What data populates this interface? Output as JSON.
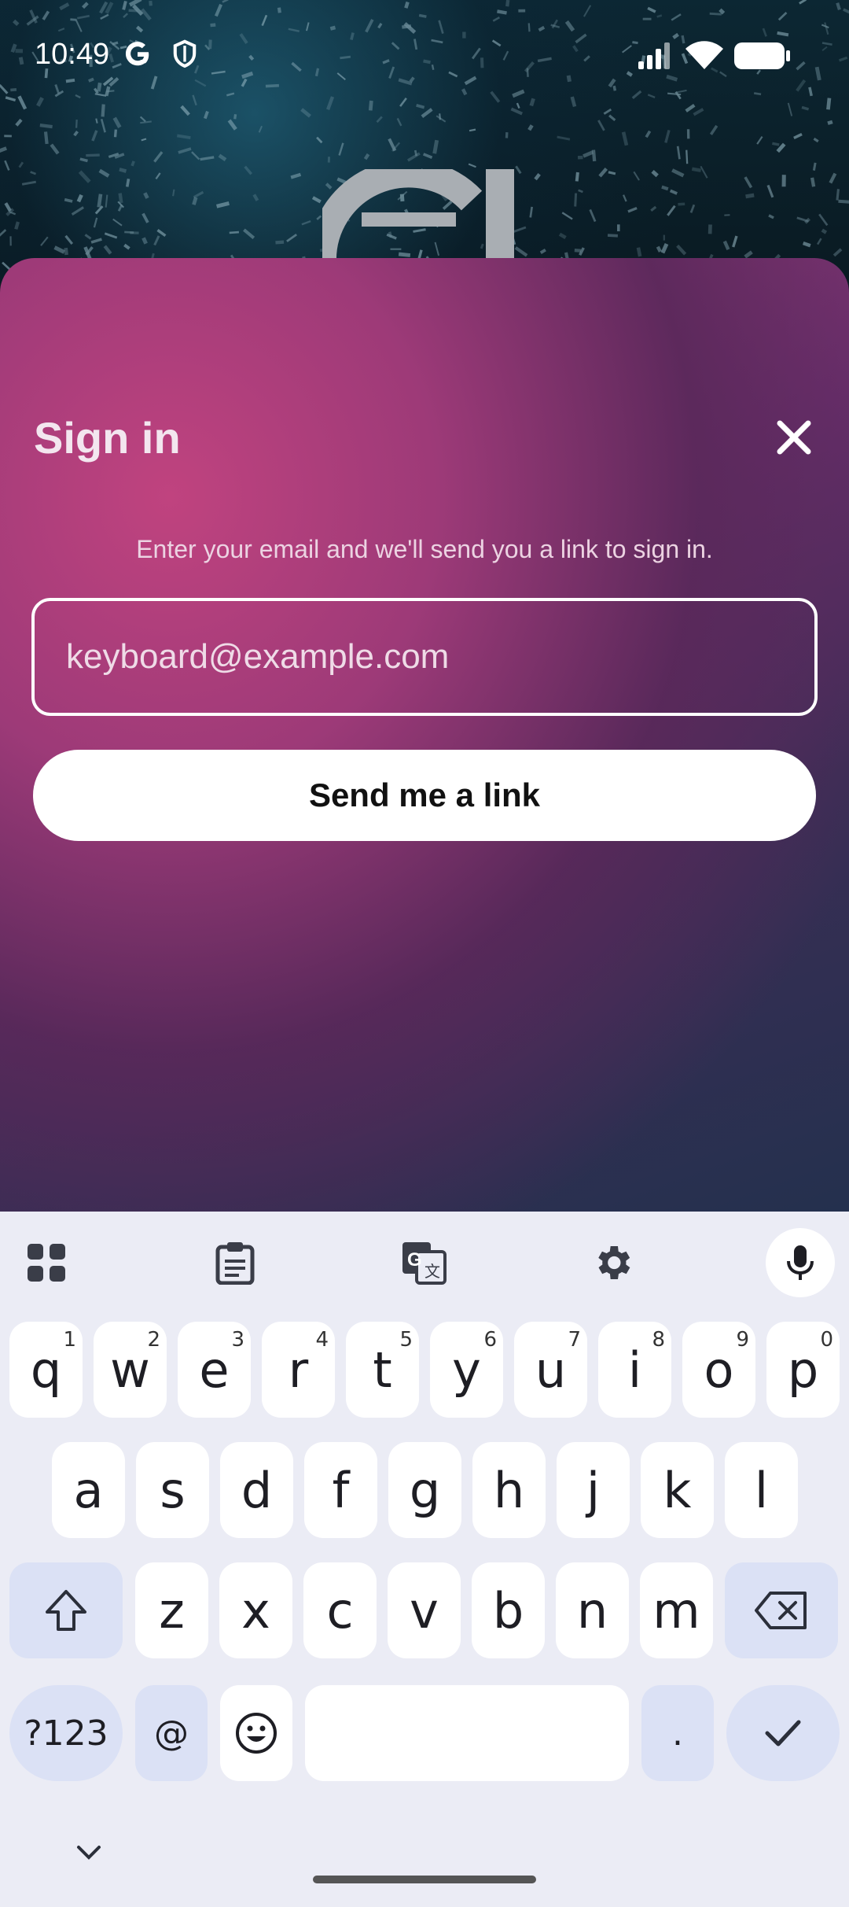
{
  "status_bar": {
    "time": "10:49",
    "icons": [
      "google-g-icon",
      "shield-icon",
      "signal-icon",
      "wifi-icon",
      "battery-icon"
    ]
  },
  "sheet": {
    "title": "Sign in",
    "subtitle": "Enter your email and we'll send you a link to sign in.",
    "email_placeholder": "keyboard@example.com",
    "send_button": "Send me a link"
  },
  "keyboard": {
    "toolbar": [
      "apps-grid-icon",
      "clipboard-icon",
      "translate-icon",
      "settings-gear-icon",
      "microphone-icon"
    ],
    "row1": [
      {
        "k": "q",
        "s": "1"
      },
      {
        "k": "w",
        "s": "2"
      },
      {
        "k": "e",
        "s": "3"
      },
      {
        "k": "r",
        "s": "4"
      },
      {
        "k": "t",
        "s": "5"
      },
      {
        "k": "y",
        "s": "6"
      },
      {
        "k": "u",
        "s": "7"
      },
      {
        "k": "i",
        "s": "8"
      },
      {
        "k": "o",
        "s": "9"
      },
      {
        "k": "p",
        "s": "0"
      }
    ],
    "row2": [
      "a",
      "s",
      "d",
      "f",
      "g",
      "h",
      "j",
      "k",
      "l"
    ],
    "row3": [
      "z",
      "x",
      "c",
      "v",
      "b",
      "n",
      "m"
    ],
    "symbols_key": "?123",
    "at_key": "@",
    "period_key": "."
  }
}
